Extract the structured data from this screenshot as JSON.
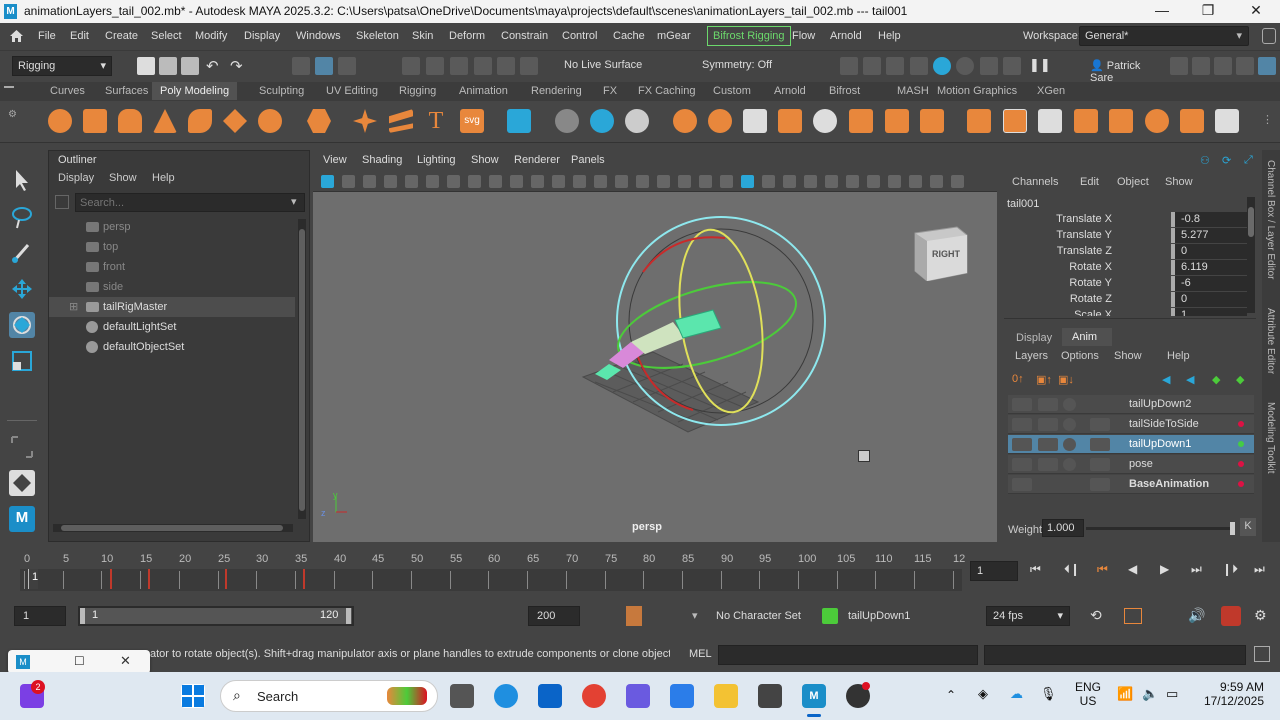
{
  "window": {
    "title": "animationLayers_tail_002.mb* - Autodesk MAYA 2025.3.2: C:\\Users\\patsa\\OneDrive\\Documents\\maya\\projects\\default\\scenes\\animationLayers_tail_002.mb  ---  tail001",
    "logo": "M",
    "minimize": "—",
    "maximize": "❐",
    "close": "✕"
  },
  "menubar": {
    "items": [
      "File",
      "Edit",
      "Create",
      "Select",
      "Modify",
      "Display",
      "Windows",
      "Skeleton",
      "Skin",
      "Deform",
      "Constrain",
      "Control",
      "Cache",
      "mGear",
      "Bifrost Rigging",
      "Flow",
      "Arnold",
      "Help"
    ],
    "workspace_label": "Workspace:",
    "workspace_value": "General*"
  },
  "statusline": {
    "menuset": "Rigging",
    "live_surface": "No Live Surface",
    "symmetry": "Symmetry: Off",
    "user": "Patrick Sare"
  },
  "shelf": {
    "tabs": [
      "Curves",
      "Surfaces",
      "Poly Modeling",
      "Sculpting",
      "UV Editing",
      "Rigging",
      "Animation",
      "Rendering",
      "FX",
      "FX Caching",
      "Custom",
      "Arnold",
      "Bifrost",
      "MASH",
      "Motion Graphics",
      "XGen"
    ],
    "active_tab": "Poly Modeling"
  },
  "outliner": {
    "title": "Outliner",
    "menus": [
      "Display",
      "Show",
      "Help"
    ],
    "search_placeholder": "Search...",
    "items": [
      {
        "name": "persp",
        "dim": true
      },
      {
        "name": "top",
        "dim": true
      },
      {
        "name": "front",
        "dim": true
      },
      {
        "name": "side",
        "dim": true
      },
      {
        "name": "tailRigMaster",
        "dim": false,
        "selected": true
      },
      {
        "name": "defaultLightSet",
        "dim": false
      },
      {
        "name": "defaultObjectSet",
        "dim": false
      }
    ]
  },
  "viewport": {
    "menus": [
      "View",
      "Shading",
      "Lighting",
      "Show",
      "Renderer",
      "Panels"
    ],
    "camera_label": "persp",
    "viewcube_label": "RIGHT",
    "axis_y": "y",
    "axis_z": "z"
  },
  "channelbox": {
    "menus": [
      "Channels",
      "Edit",
      "Object",
      "Show"
    ],
    "object": "tail001",
    "channels": [
      {
        "label": "Translate X",
        "value": "-0.8"
      },
      {
        "label": "Translate Y",
        "value": "5.277"
      },
      {
        "label": "Translate Z",
        "value": "0"
      },
      {
        "label": "Rotate X",
        "value": "6.119"
      },
      {
        "label": "Rotate Y",
        "value": "-6"
      },
      {
        "label": "Rotate Z",
        "value": "0"
      },
      {
        "label": "Scale X",
        "value": "1"
      }
    ]
  },
  "layers": {
    "tabs": [
      "Display",
      "Anim"
    ],
    "active_tab": "Anim",
    "menus": [
      "Layers",
      "Options",
      "Show",
      "Help"
    ],
    "rows": [
      {
        "name": "tailUpDown2",
        "selected": false,
        "bold": false,
        "dot": ""
      },
      {
        "name": "tailSideToSide",
        "selected": false,
        "bold": false,
        "dot": "#d14"
      },
      {
        "name": "tailUpDown1",
        "selected": true,
        "bold": false,
        "dot": "#4c4"
      },
      {
        "name": "pose",
        "selected": false,
        "bold": false,
        "dot": "#d14"
      },
      {
        "name": "BaseAnimation",
        "selected": false,
        "bold": true,
        "dot": "#d14"
      }
    ],
    "weight_label": "Weight",
    "weight_value": "1.000",
    "key_label": "K"
  },
  "sidetabs": [
    "Channel Box / Layer Editor",
    "Attribute Editor",
    "Modeling Toolkit"
  ],
  "timeline": {
    "ticks": [
      "0",
      "5",
      "10",
      "15",
      "20",
      "25",
      "30",
      "35",
      "40",
      "45",
      "50",
      "55",
      "60",
      "65",
      "70",
      "75",
      "80",
      "85",
      "90",
      "95",
      "100",
      "105",
      "110",
      "115",
      "12"
    ],
    "current_frame": "1",
    "frame_field": "1"
  },
  "rangebar": {
    "start": "1",
    "range_start": "1",
    "range_end": "120",
    "end": "200",
    "character_set": "No Character Set",
    "anim_layer": "tailUpDown1",
    "fps": "24 fps"
  },
  "cmdline": {
    "help_text": "ator to rotate object(s). Shift+drag manipulator axis or plane handles to extrude components or clone objects. Ctrl+Sh",
    "lang": "MEL"
  },
  "taskbar": {
    "search_label": "Search",
    "badge": "2",
    "lang_top": "ENG",
    "lang_bottom": "US",
    "time": "9:59 AM",
    "date": "17/12/2025"
  },
  "colors": {
    "accent": "#5285a6",
    "bifrost": "#6cd96c",
    "selected_layer": "#5285a6"
  }
}
